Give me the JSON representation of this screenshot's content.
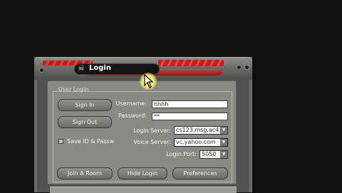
{
  "window": {
    "title": "Login"
  },
  "group": {
    "title": "User Login"
  },
  "buttons": {
    "sign_in": "Sign In",
    "sign_out": "Sign Out",
    "join_room": "Join A Room",
    "hide_login": "Hide Login",
    "preferences": "Preferences"
  },
  "checkbox": {
    "save_id_label": "Save ID & Passw",
    "checked": false
  },
  "fields": {
    "username_label": "Username:",
    "username_value": "hhhh",
    "password_label": "Password:",
    "password_value": "**",
    "login_server_label": "Login Server:",
    "login_server_value": "cs123.msg.ac4.y",
    "voice_server_label": "Voice Server:",
    "voice_server_value": "vc.yahoo.com",
    "login_port_label": "Login Port:",
    "login_port_value": "5050"
  },
  "colors": {
    "accent_red": "#c51e1e",
    "frame_grey": "#525250",
    "panel_grey": "#8a8a85",
    "background": "#0f0f0d"
  },
  "icons": [
    "skull-icon",
    "mouse-cursor-icon",
    "dropdown-arrow-icon"
  ]
}
